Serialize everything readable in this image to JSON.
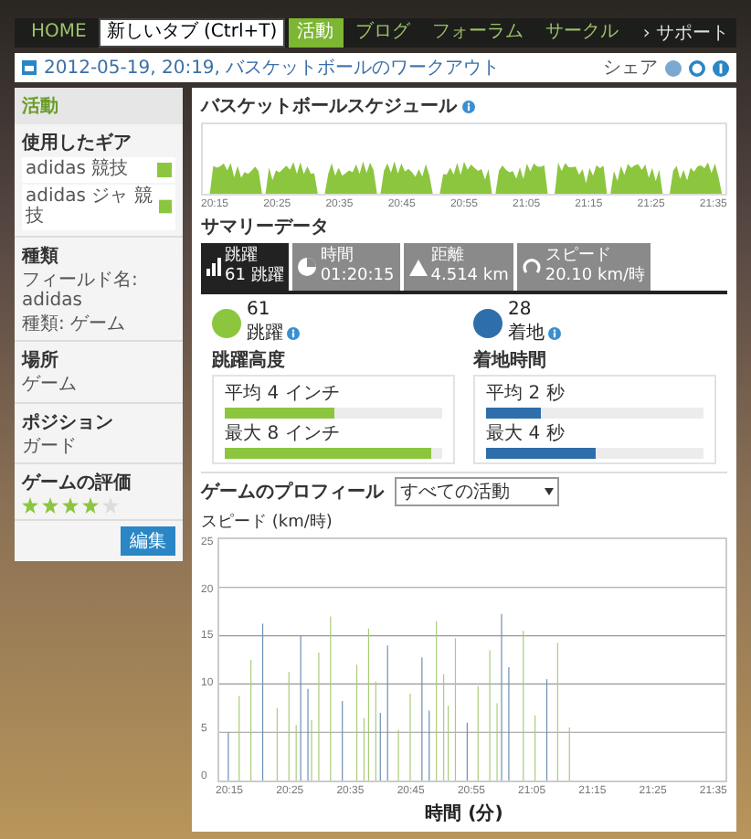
{
  "nav": {
    "items": [
      {
        "label": "HOME",
        "kind": "item",
        "selected": false
      },
      {
        "label": "新しいタブ (Ctrl+T)",
        "kind": "tooltip"
      },
      {
        "label": "活動",
        "kind": "item",
        "selected": true
      },
      {
        "label": "ブログ",
        "kind": "item",
        "selected": false
      },
      {
        "label": "フォーラム",
        "kind": "item",
        "selected": false
      },
      {
        "label": "サークル",
        "kind": "item",
        "selected": false
      }
    ],
    "support": "› サポート"
  },
  "breadcrumb": {
    "text": "2012-05-19, 20:19, バスケットボールのワークアウト",
    "share": "シェア"
  },
  "sidebar": {
    "title": "活動",
    "gear_title": "使用したギア",
    "gear": [
      "adidas 競技",
      "adidas ジャ 競技"
    ],
    "sections": [
      {
        "heading": "種類",
        "lines": [
          "フィールド名: adidas",
          "種類: ゲーム"
        ]
      },
      {
        "heading": "場所",
        "lines": [
          "ゲーム"
        ]
      },
      {
        "heading": "ポジション",
        "lines": [
          "ガード"
        ]
      }
    ],
    "rating_title": "ゲームの評価",
    "stars": 4,
    "edit": "編集"
  },
  "schedule": {
    "title": "バスケットボールスケジュール",
    "x_labels": [
      "20:15",
      "20:25",
      "20:35",
      "20:45",
      "20:55",
      "21:05",
      "21:15",
      "21:25",
      "21:35"
    ]
  },
  "summary": {
    "title": "サマリーデータ",
    "tabs": [
      {
        "label": "跳躍",
        "value": "61 跳躍",
        "kind": "jump",
        "selected": true
      },
      {
        "label": "時間",
        "value": "01:20:15",
        "kind": "time",
        "selected": false
      },
      {
        "label": "距離",
        "value": "4.514 km",
        "kind": "distance",
        "selected": false
      },
      {
        "label": "スピード",
        "value": "20.10 km/時",
        "kind": "speed",
        "selected": false
      }
    ],
    "stats": [
      {
        "count": "61",
        "label": "跳躍",
        "heading": "跳躍高度",
        "color": "#8cc63f",
        "rows": [
          {
            "label": "平均",
            "value": "4",
            "unit": "インチ",
            "level": 0.5
          },
          {
            "label": "最大",
            "value": "8",
            "unit": "インチ",
            "level": 0.95
          }
        ]
      },
      {
        "count": "28",
        "label": "着地",
        "heading": "着地時間",
        "color": "#2e6eab",
        "rows": [
          {
            "label": "平均",
            "value": "2",
            "unit": "秒",
            "level": 0.25
          },
          {
            "label": "最大",
            "value": "4",
            "unit": "秒",
            "level": 0.5
          }
        ]
      }
    ]
  },
  "profile": {
    "label": "ゲームのプロフィール",
    "select": "すべての活動",
    "y_label": "スピード (km/時)",
    "y_ticks": [
      "25",
      "20",
      "15",
      "10",
      "5",
      "0"
    ],
    "x_labels": [
      "20:15",
      "20:25",
      "20:35",
      "20:45",
      "20:55",
      "21:05",
      "21:15",
      "21:25",
      "21:35"
    ],
    "x_title": "時間 (分)"
  }
}
